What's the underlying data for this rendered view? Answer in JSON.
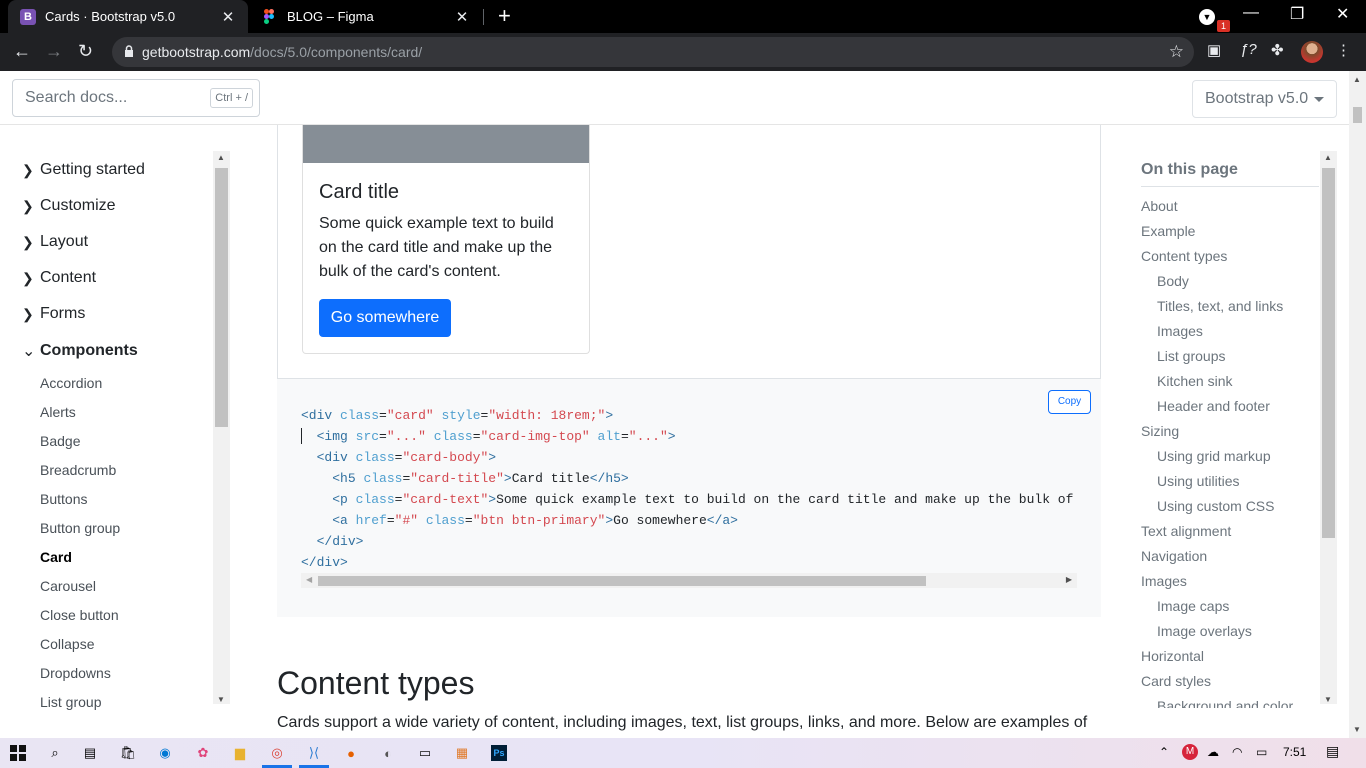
{
  "browser": {
    "tabs": [
      {
        "title": "Cards · Bootstrap v5.0",
        "favicon": "B"
      },
      {
        "title": "BLOG – Figma"
      }
    ],
    "url_host": "getbootstrap.com",
    "url_path": "/docs/5.0/components/card/",
    "ext_badge": "1"
  },
  "topnav": {
    "search_placeholder": "Search docs...",
    "search_shortcut": "Ctrl + /",
    "version": "Bootstrap v5.0"
  },
  "sidebar": {
    "groups": [
      {
        "label": "Getting started"
      },
      {
        "label": "Customize"
      },
      {
        "label": "Layout"
      },
      {
        "label": "Content"
      },
      {
        "label": "Forms"
      },
      {
        "label": "Components"
      }
    ],
    "items": [
      "Accordion",
      "Alerts",
      "Badge",
      "Breadcrumb",
      "Buttons",
      "Button group",
      "Card",
      "Carousel",
      "Close button",
      "Collapse",
      "Dropdowns",
      "List group"
    ]
  },
  "example": {
    "card_title": "Card title",
    "card_text": "Some quick example text to build on the card title and make up the bulk of the card's content.",
    "button": "Go somewhere"
  },
  "code": {
    "copy_label": "Copy"
  },
  "content": {
    "heading": "Content types",
    "paragraph": "Cards support a wide variety of content, including images, text, list groups, links, and more. Below are examples of"
  },
  "toc": {
    "heading": "On this page",
    "items": [
      "About",
      "Example",
      "Content types",
      "Body",
      "Titles, text, and links",
      "Images",
      "List groups",
      "Kitchen sink",
      "Header and footer",
      "Sizing",
      "Using grid markup",
      "Using utilities",
      "Using custom CSS",
      "Text alignment",
      "Navigation",
      "Images",
      "Image caps",
      "Image overlays",
      "Horizontal",
      "Card styles",
      "Background and color"
    ]
  },
  "taskbar": {
    "time": "7:51"
  },
  "colors": {
    "primary": "#0d6efd",
    "bootstrap_purple": "#7952b3"
  }
}
